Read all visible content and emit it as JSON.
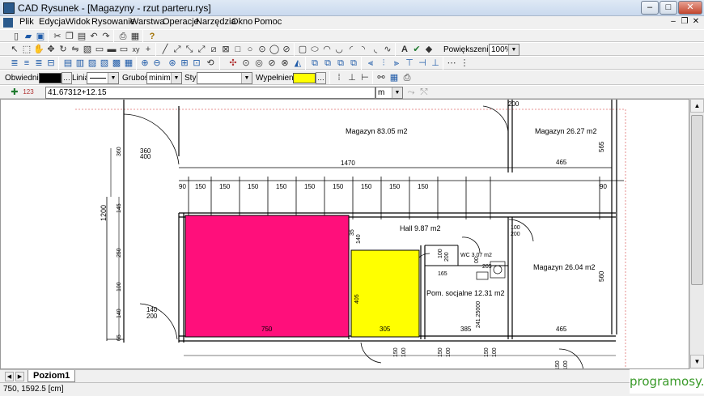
{
  "window": {
    "title": "CAD Rysunek - [Magazyny - rzut parteru.rys]",
    "minimize": "–",
    "maximize": "□",
    "close": "✕"
  },
  "menu": {
    "items": [
      "Plik",
      "Edycja",
      "Widok",
      "Rysowanie",
      "Warstwa",
      "Operacje",
      "Narzędzia",
      "Okno",
      "Pomoc"
    ],
    "mdi_minimize": "–",
    "mdi_restore": "❐",
    "mdi_close": "✕"
  },
  "zoom": {
    "label": "Powiększenie:",
    "value": "100%"
  },
  "props": {
    "outline_label": "Obwiednia:",
    "line_label": "Linia:",
    "thickness_label": "Grubość:",
    "thickness_value": "minimalna",
    "style_label": "Styl:",
    "style_value": "",
    "fill_label": "Wypełnienie:",
    "outline_color": "#000000",
    "fill_color": "#ffff00"
  },
  "coord": {
    "value": "41.67312+12.15",
    "unit": "m"
  },
  "drawing": {
    "rooms": [
      {
        "name": "Magazyn 83.05 m2"
      },
      {
        "name": "Magazyn 26.27 m2"
      },
      {
        "name": "Hall 9.87 m2"
      },
      {
        "name": "WC 3.07 m2"
      },
      {
        "name": "Magazyn 26.04 m2"
      },
      {
        "name": "Pom. socjalne 12.31 m2"
      }
    ],
    "dimensions": {
      "top_total": "1470",
      "left_total": "1200",
      "top_right_a": "200",
      "right_a": "565",
      "right_b": "560",
      "top_segments": [
        "90",
        "150",
        "150",
        "150",
        "150",
        "150",
        "150",
        "150",
        "150",
        "150"
      ],
      "right_segments": [
        "465",
        "90"
      ],
      "left_door": "360",
      "left_door_b": "400",
      "left_segs": [
        "360",
        "145",
        "250",
        "100",
        "140",
        "65"
      ],
      "left_door2": "140",
      "left_door2_b": "200",
      "bottom": [
        "750",
        "305",
        "385",
        "465"
      ],
      "bottom_extra": [
        "150",
        "100",
        "150",
        "100",
        "150",
        "100",
        "150",
        "100"
      ],
      "mid_misc": [
        "35",
        "140",
        "100",
        "200",
        "100",
        "200",
        "165",
        "405",
        "205",
        "241.25000",
        "00"
      ]
    },
    "fill_magenta": "#ff0f7b",
    "fill_yellow": "#ffff00"
  },
  "sheet_tab": "Poziom1",
  "status": "750, 1592.5 [cm]",
  "watermark": "programosy.pl"
}
